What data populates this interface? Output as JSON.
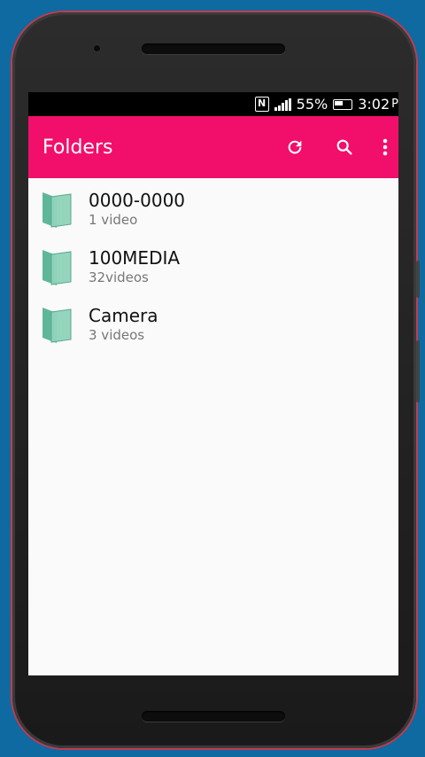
{
  "status": {
    "nfc": "N",
    "battery_percent": "55%",
    "time": "3:02",
    "time_suffix": "P"
  },
  "appbar": {
    "title": "Folders",
    "refresh_icon": "refresh-icon",
    "search_icon": "search-icon",
    "more_icon": "more-vert-icon",
    "color": "#f20f6b"
  },
  "folders": [
    {
      "name": "0000-0000",
      "count": "1 video"
    },
    {
      "name": "100MEDIA",
      "count": "32videos"
    },
    {
      "name": "Camera",
      "count": "3 videos"
    }
  ],
  "colors": {
    "background": "#0e6aa0",
    "folder_icon": "#7fc9a8"
  }
}
